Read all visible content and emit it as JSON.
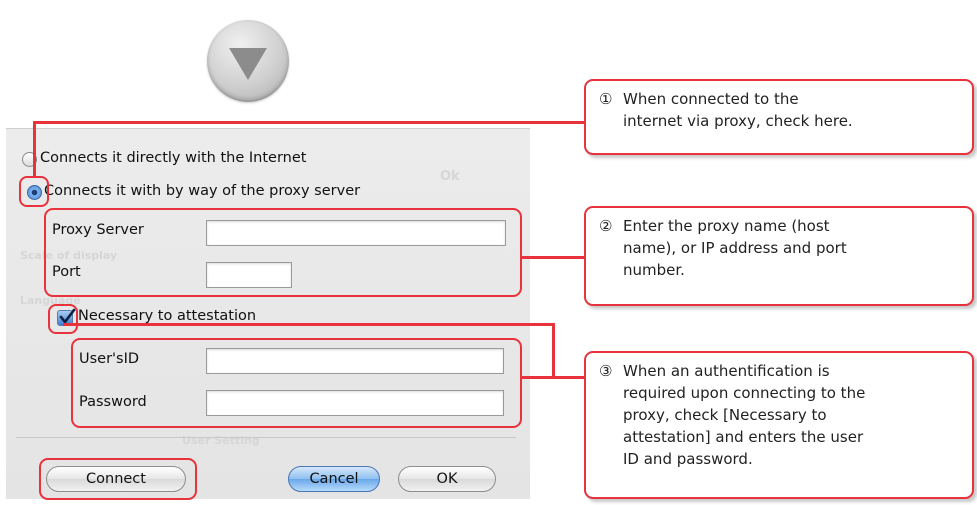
{
  "dialog": {
    "radio_direct": "Connects it directly with the Internet",
    "radio_proxy": "Connects it with by way of the proxy server",
    "proxy_server_label": "Proxy Server",
    "proxy_server_value": "",
    "port_label": "Port",
    "port_value": "",
    "auth_checkbox_label": "Necessary to attestation",
    "auth_checked": true,
    "userid_label": "User'sID",
    "userid_value": "",
    "password_label": "Password",
    "password_value": "",
    "connect_button": "Connect",
    "cancel_button": "Cancel",
    "ok_button": "OK"
  },
  "callouts": [
    {
      "number": "①",
      "lines": [
        "When connected to the",
        "internet via proxy, check here."
      ]
    },
    {
      "number": "②",
      "lines": [
        "Enter the proxy name (host",
        "name), or IP address and port",
        "number."
      ]
    },
    {
      "number": "③",
      "lines": [
        "When an authentification is",
        "required upon connecting to the",
        "proxy, check [Necessary to",
        "attestation] and enters the user",
        "ID and password."
      ]
    }
  ],
  "colors": {
    "highlight": "#e8333c",
    "radio_selected": "#4d8ad8",
    "default_button": "#6aa8ea"
  },
  "icons": {
    "arrow": "down-arrow-icon",
    "checkmark": "checkmark-icon"
  }
}
